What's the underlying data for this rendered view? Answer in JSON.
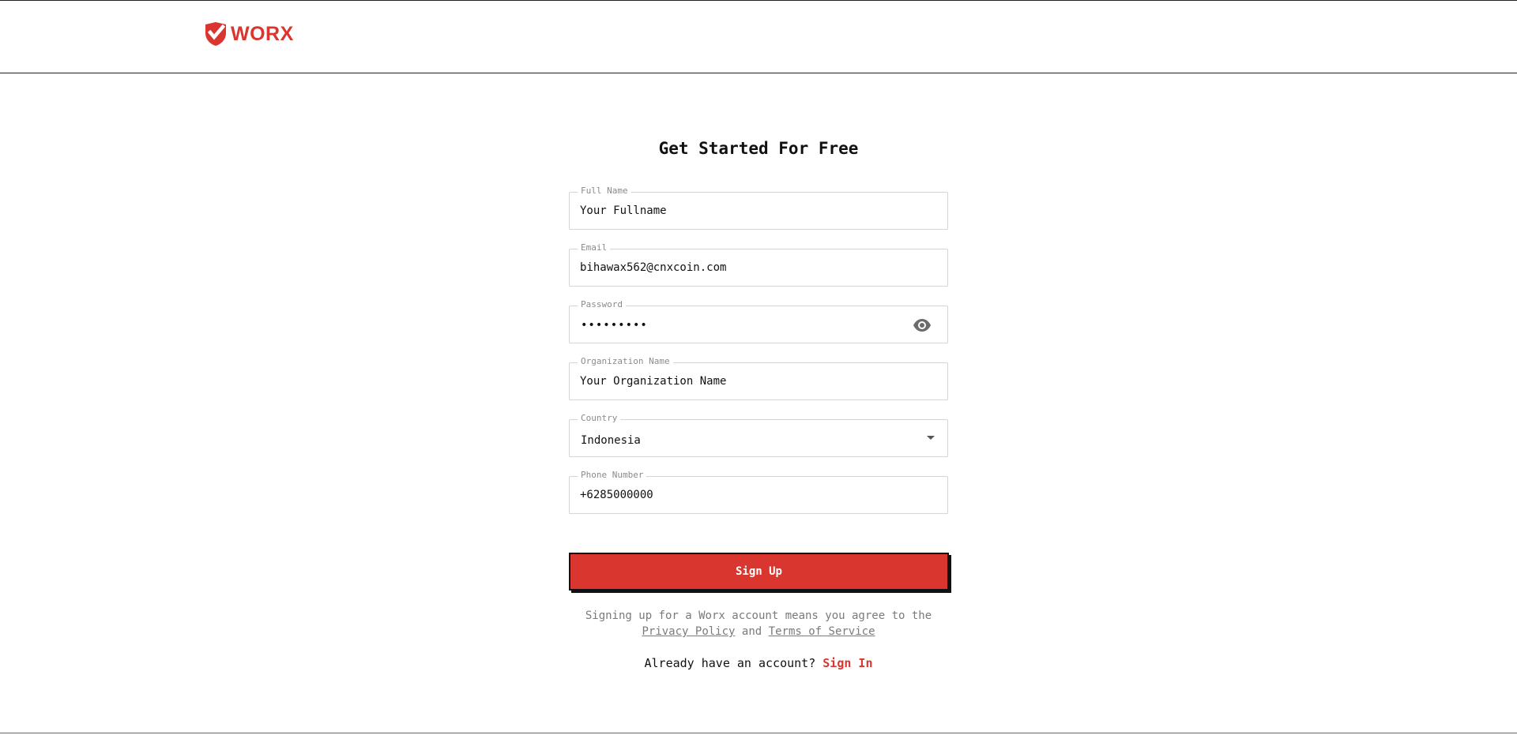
{
  "header": {
    "logo_text": "WORX",
    "logo_icon": "shield-check-icon",
    "brand_color": "#d93630"
  },
  "form": {
    "title": "Get Started For Free",
    "full_name": {
      "label": "Full Name",
      "placeholder": "Your Fullname",
      "value": ""
    },
    "email": {
      "label": "Email",
      "value": "bihawax562@cnxcoin.com"
    },
    "password": {
      "label": "Password",
      "value": "•••••••••",
      "toggle_icon": "eye-icon"
    },
    "organization": {
      "label": "Organization Name",
      "placeholder": "Your Organization Name",
      "value": ""
    },
    "country": {
      "label": "Country",
      "selected": "Indonesia",
      "icon": "caret-down-icon"
    },
    "phone": {
      "label": "Phone Number",
      "value": "+6285000000"
    },
    "submit_label": "Sign Up",
    "agreement": {
      "prefix": "Signing up for a Worx account means you agree to the",
      "privacy_link": "Privacy Policy",
      "conjunction": "and",
      "terms_link": "Terms of Service"
    },
    "signin": {
      "prompt": "Already have an account?",
      "link": "Sign In"
    }
  }
}
